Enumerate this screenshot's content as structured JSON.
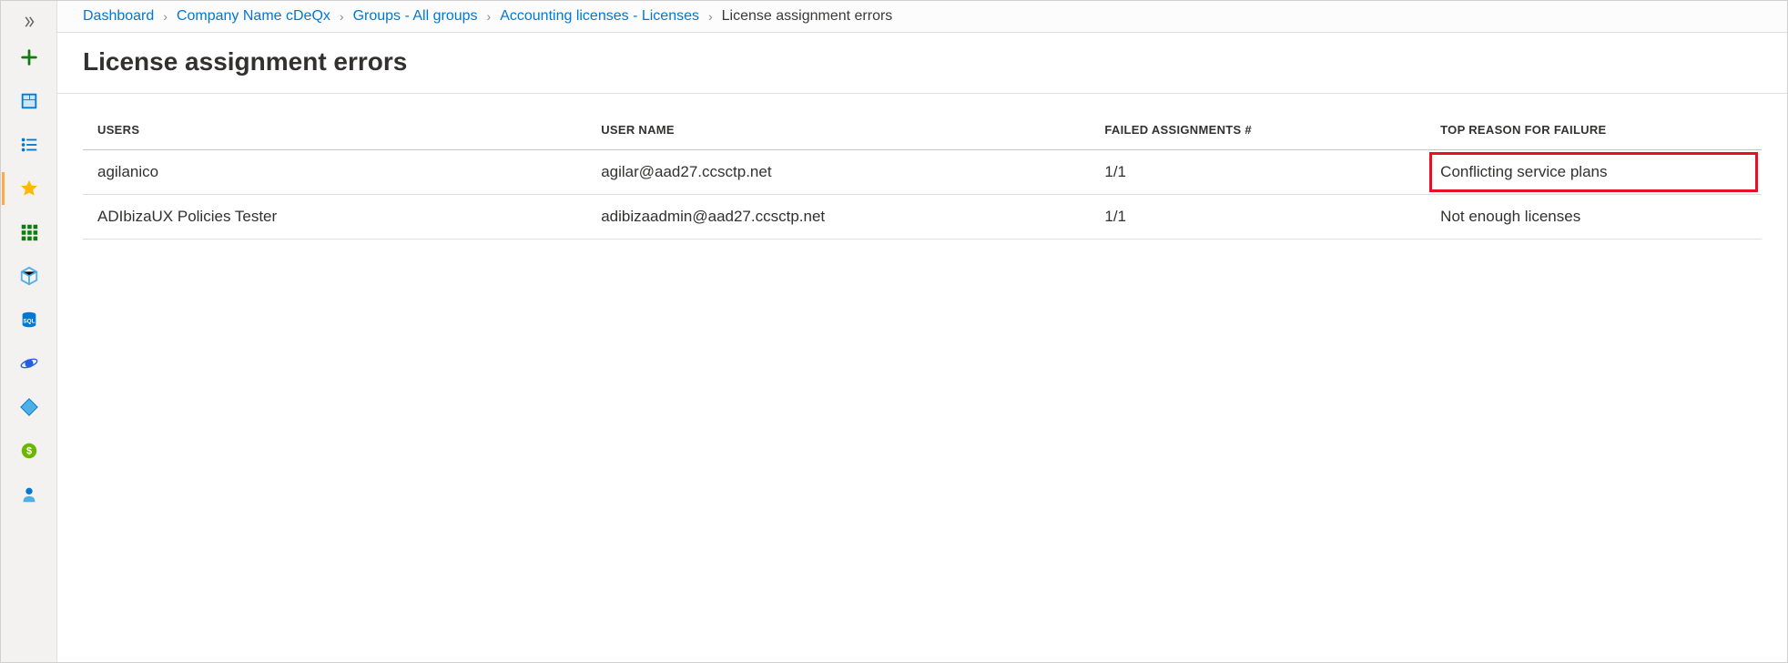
{
  "sidebar": {
    "expand_icon": "chevron-double-right",
    "items": [
      {
        "name": "new-resource",
        "icon": "plus",
        "color": "#107c10"
      },
      {
        "name": "dashboard",
        "icon": "dashboard",
        "color": "#0078d4"
      },
      {
        "name": "all-resources",
        "icon": "list",
        "color": "#0078d4"
      },
      {
        "name": "favorites",
        "icon": "star",
        "color": "#ffb900",
        "active_indicator": true
      },
      {
        "name": "resource-groups",
        "icon": "grid",
        "color": "#107c10"
      },
      {
        "name": "app-services",
        "icon": "cube",
        "color": "#50b0e6"
      },
      {
        "name": "sql-databases",
        "icon": "sql",
        "color": "#0078d4"
      },
      {
        "name": "azure-cosmos-db",
        "icon": "cosmos",
        "color": "#2560e0"
      },
      {
        "name": "azure-ad",
        "icon": "diamond",
        "color": "#0078d4"
      },
      {
        "name": "cost-management",
        "icon": "dollar",
        "color": "#6bb700"
      },
      {
        "name": "help-support",
        "icon": "support",
        "color": "#0078d4"
      }
    ]
  },
  "breadcrumb": {
    "items": [
      {
        "label": "Dashboard",
        "link": true
      },
      {
        "label": "Company Name cDeQx",
        "link": true
      },
      {
        "label": "Groups - All groups",
        "link": true
      },
      {
        "label": "Accounting licenses - Licenses",
        "link": true
      },
      {
        "label": "License assignment errors",
        "link": false
      }
    ]
  },
  "page": {
    "title": "License assignment errors"
  },
  "table": {
    "columns": {
      "users": "USERS",
      "user_name": "USER NAME",
      "failed": "FAILED ASSIGNMENTS #",
      "reason": "TOP REASON FOR FAILURE"
    },
    "rows": [
      {
        "users": "agilanico",
        "user_name": "agilar@aad27.ccsctp.net",
        "failed": "1/1",
        "reason": "Conflicting service plans",
        "reason_highlighted": true
      },
      {
        "users": "ADIbizaUX Policies Tester",
        "user_name": "adibizaadmin@aad27.ccsctp.net",
        "failed": "1/1",
        "reason": "Not enough licenses",
        "reason_highlighted": false
      }
    ]
  },
  "colors": {
    "link": "#0078d4",
    "highlight_border": "#e81123"
  }
}
